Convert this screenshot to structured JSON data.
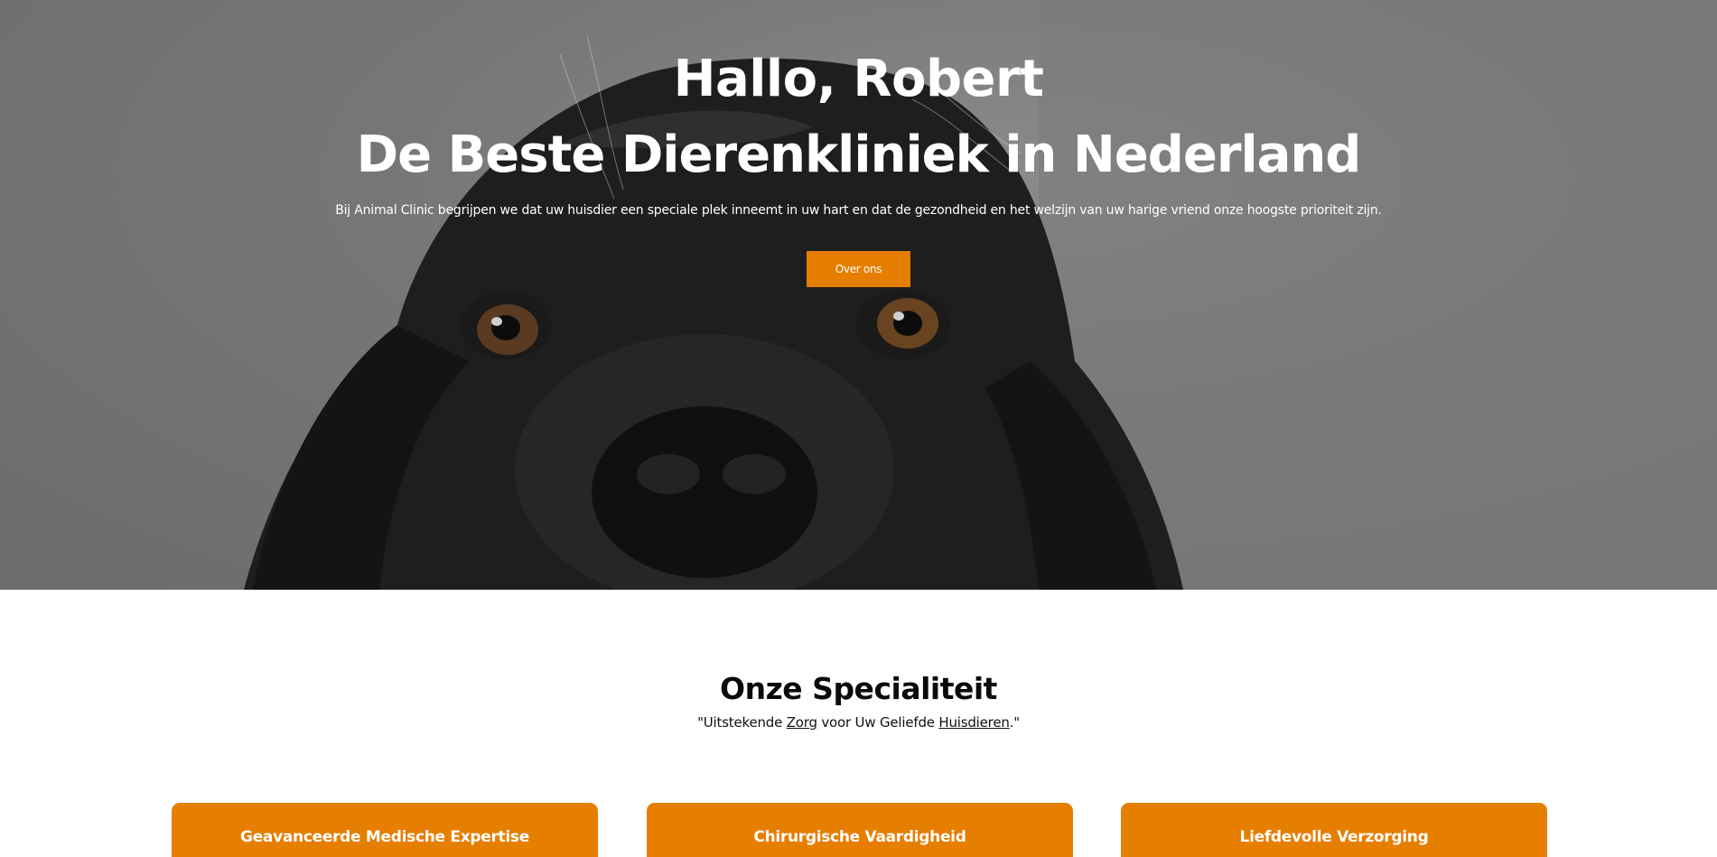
{
  "hero": {
    "greeting": "Hallo, Robert",
    "title": "De Beste Dierenkliniek in Nederland",
    "subtitle": "Bij Animal Clinic begrijpen we dat uw huisdier een speciale plek inneemt in uw hart en dat de gezondheid en het welzijn van uw harige vriend onze hoogste prioriteit zijn.",
    "cta_label": "Over ons"
  },
  "specialty": {
    "title": "Onze Specialiteit",
    "quote_open": "\"Uitstekende ",
    "quote_link1": "Zorg",
    "quote_mid": " voor Uw Geliefde ",
    "quote_link2": "Huisdieren",
    "quote_close": ".\""
  },
  "cards": [
    {
      "title": "Geavanceerde Medische Expertise"
    },
    {
      "title": "Chirurgische Vaardigheid"
    },
    {
      "title": "Liefdevolle Verzorging"
    }
  ],
  "colors": {
    "accent": "#e67e00",
    "hero_overlay": "#767676",
    "text_light": "#ffffff"
  }
}
